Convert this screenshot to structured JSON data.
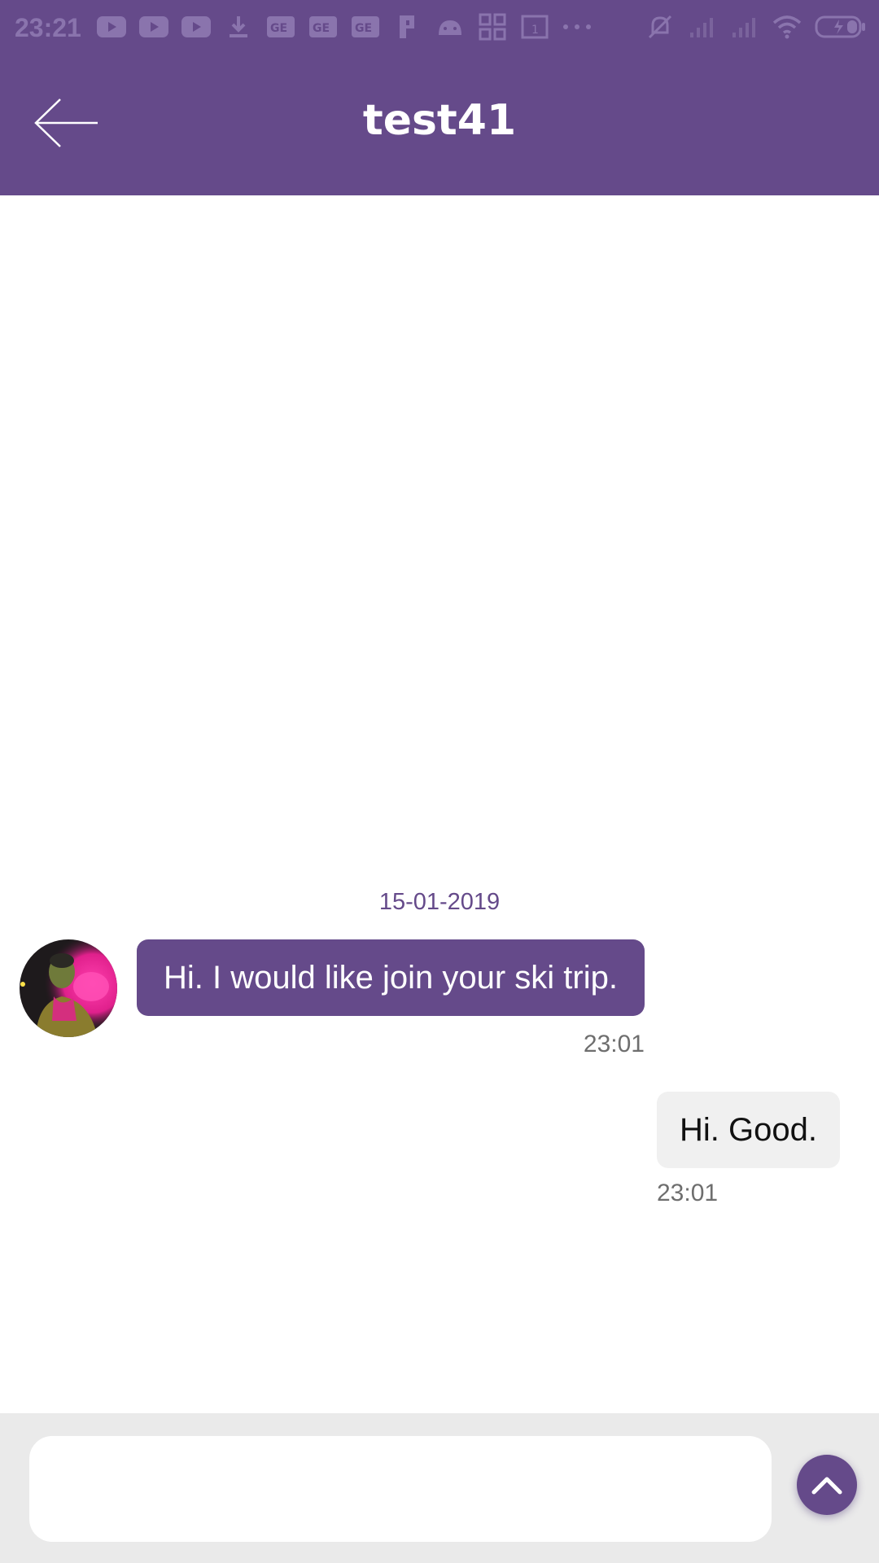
{
  "status_bar": {
    "time": "23:21",
    "icons": [
      "youtube-icon",
      "youtube-icon",
      "youtube-icon",
      "download-icon",
      "ge-icon",
      "ge-icon",
      "ge-icon",
      "parking-icon",
      "android-icon",
      "apps-icon",
      "calendar-icon",
      "more-icon"
    ],
    "right_icons": [
      "bell-off-icon",
      "signal-icon",
      "signal-icon",
      "wifi-icon",
      "battery-icon"
    ],
    "calendar_day": "1"
  },
  "app_bar": {
    "title": "test41",
    "background": "#654a8a"
  },
  "chat": {
    "date": "15-01-2019",
    "messages": [
      {
        "direction": "incoming",
        "text": "Hi. I would like join your ski trip.",
        "time": "23:01"
      },
      {
        "direction": "outgoing",
        "text": "Hi. Good.",
        "time": "23:01"
      }
    ]
  },
  "composer": {
    "placeholder": "",
    "value": ""
  },
  "colors": {
    "accent": "#654a8a",
    "incoming_bubble": "#654a8a",
    "outgoing_bubble": "#f0f0f0",
    "composer_bg": "#eaeaea"
  }
}
